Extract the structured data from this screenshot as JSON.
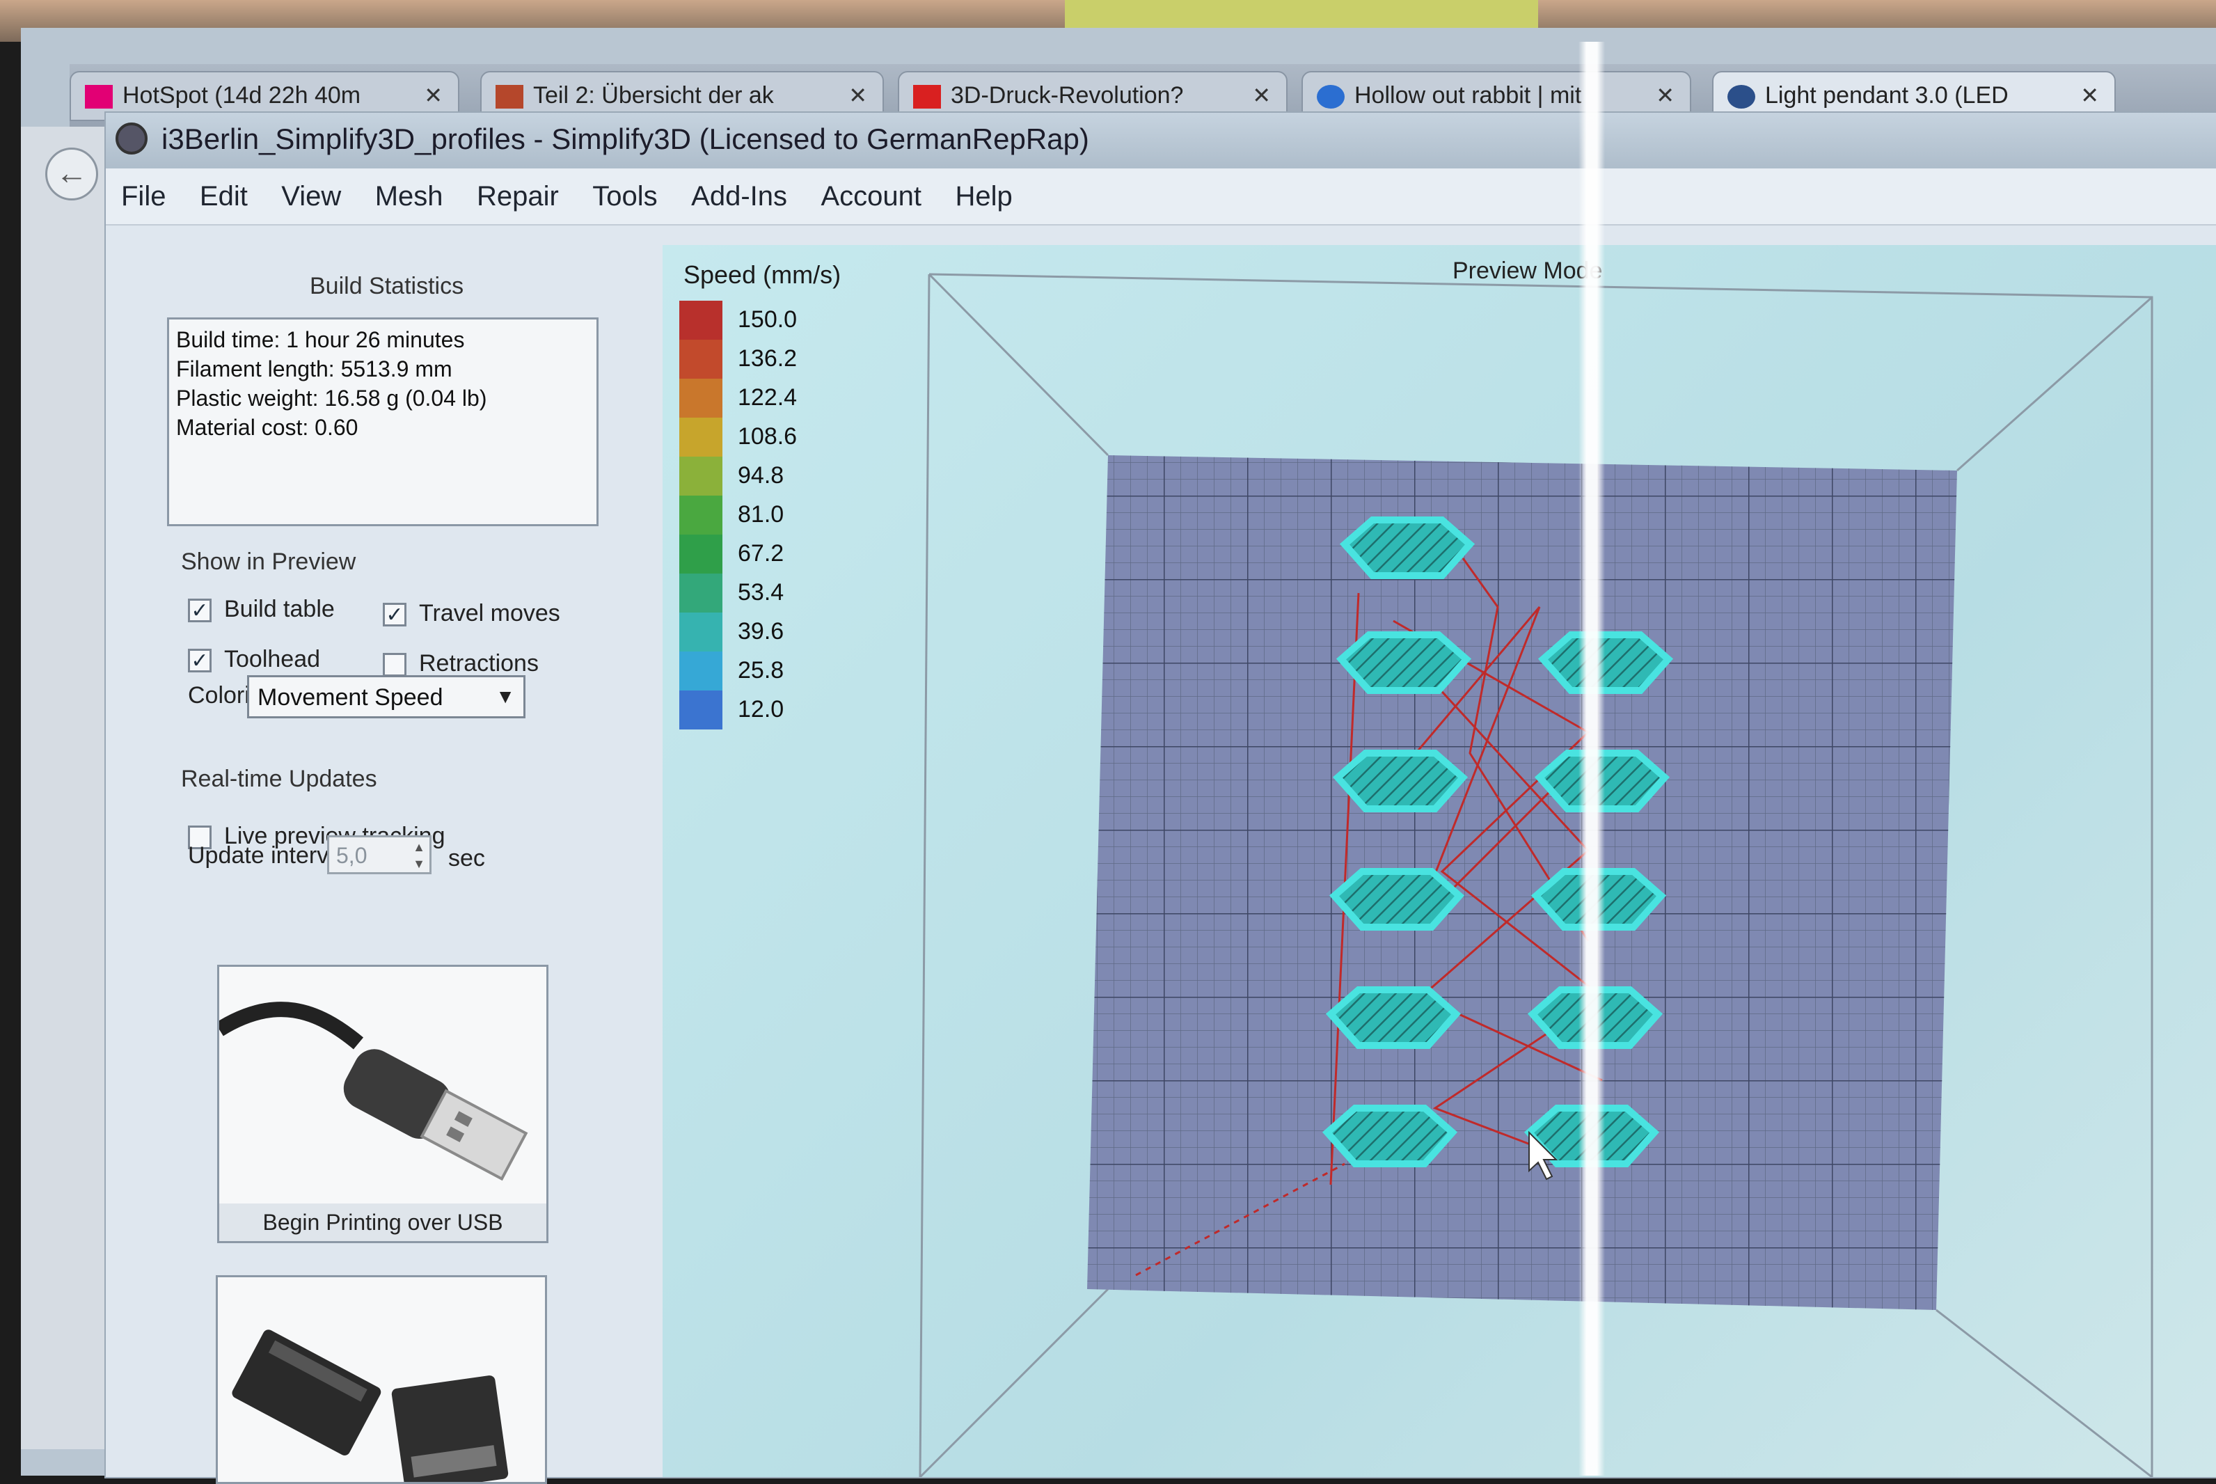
{
  "browser": {
    "tabs": [
      {
        "label": "HotSpot (14d 22h 40m",
        "icon": "telekom-icon",
        "color": "#e20074"
      },
      {
        "label": "Teil 2: Übersicht der ak",
        "icon": "3d-icon",
        "color": "#b5472b"
      },
      {
        "label": "3D-Druck-Revolution?",
        "icon": "youtube-icon",
        "color": "#d92020"
      },
      {
        "label": "Hollow out rabbit | mit",
        "icon": "globe-icon",
        "color": "#2b6ed1"
      },
      {
        "label": "Light pendant 3.0 (LED",
        "icon": "globe-icon",
        "color": "#2b4f8a"
      }
    ]
  },
  "app": {
    "title": "i3Berlin_Simplify3D_profiles - Simplify3D (Licensed to GermanRepRap)",
    "menu": [
      "File",
      "Edit",
      "View",
      "Mesh",
      "Repair",
      "Tools",
      "Add-Ins",
      "Account",
      "Help"
    ]
  },
  "build_statistics": {
    "title": "Build Statistics",
    "lines": [
      "Build time: 1 hour 26 minutes",
      "Filament length: 5513.9 mm",
      "Plastic weight: 16.58 g (0.04 lb)",
      "Material cost: 0.60"
    ]
  },
  "show_in_preview": {
    "title": "Show in Preview",
    "build_table": {
      "label": "Build table",
      "checked": true
    },
    "travel_moves": {
      "label": "Travel moves",
      "checked": true
    },
    "toolhead": {
      "label": "Toolhead",
      "checked": true
    },
    "retractions": {
      "label": "Retractions",
      "checked": false
    },
    "coloring_label": "Coloring",
    "coloring_value": "Movement Speed"
  },
  "realtime_updates": {
    "title": "Real-time Updates",
    "live_preview": {
      "label": "Live preview tracking",
      "checked": false
    },
    "update_interval_label": "Update interval",
    "update_interval_value": "5,0",
    "update_interval_unit": "sec"
  },
  "actions": {
    "usb_label": "Begin Printing over USB"
  },
  "preview": {
    "mode_label": "Preview Mode",
    "legend_title": "Speed (mm/s)",
    "legend": [
      {
        "value": "150.0",
        "color": "#b8302c"
      },
      {
        "value": "136.2",
        "color": "#c24a2c"
      },
      {
        "value": "122.4",
        "color": "#c9772c"
      },
      {
        "value": "108.6",
        "color": "#c7a52c"
      },
      {
        "value": "94.8",
        "color": "#8bb13a"
      },
      {
        "value": "81.0",
        "color": "#4aa840"
      },
      {
        "value": "67.2",
        "color": "#2f9f49"
      },
      {
        "value": "53.4",
        "color": "#33a87a"
      },
      {
        "value": "39.6",
        "color": "#36b3b0"
      },
      {
        "value": "25.8",
        "color": "#36a8d6"
      },
      {
        "value": "12.0",
        "color": "#3b74d0"
      }
    ],
    "part_color": "#2fc7c7",
    "travel_color": "#c02a2a"
  }
}
